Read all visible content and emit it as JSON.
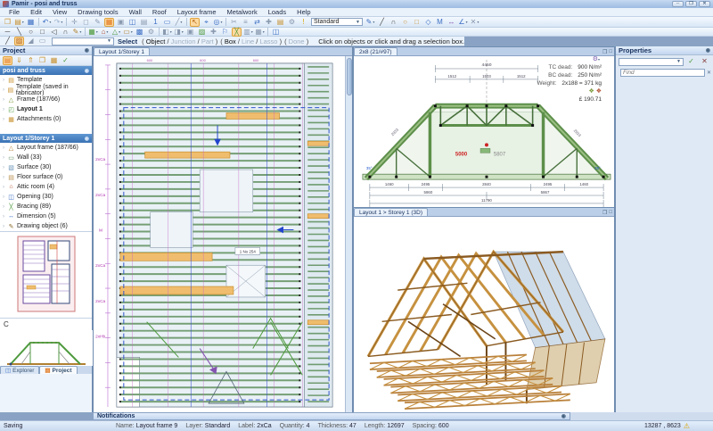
{
  "window": {
    "title": "Pamir - posi and truss",
    "buttons": [
      "─",
      "❐",
      "✕"
    ]
  },
  "menu": {
    "items": [
      "File",
      "Edit",
      "View",
      "Drawing tools",
      "Wall",
      "Roof",
      "Layout frame",
      "Metalwork",
      "Loads",
      "Help"
    ]
  },
  "toolbar1": {
    "standard_combo": "Standard",
    "icons": [
      {
        "name": "new-document-icon",
        "glyph": "❒",
        "color": "#c8922f"
      },
      {
        "name": "open-project-icon",
        "glyph": "▤",
        "color": "#c8922f",
        "dd": true
      },
      {
        "name": "save-icon",
        "glyph": "▦",
        "color": "#3c6fc4"
      },
      {
        "sep": true
      },
      {
        "name": "undo-icon",
        "glyph": "↶",
        "color": "#3c6fc4",
        "dd": true
      },
      {
        "name": "redo-icon",
        "glyph": "↷",
        "color": "#9db4d0",
        "dd": true
      },
      {
        "sep": true
      },
      {
        "name": "pan-icon",
        "glyph": "✛",
        "color": "#8a9ab0"
      },
      {
        "name": "zoom-extents-icon",
        "glyph": "◻",
        "color": "#8a9ab0"
      },
      {
        "name": "edit-icon",
        "glyph": "✎",
        "color": "#8a9ab0"
      },
      {
        "name": "layout-view-icon",
        "glyph": "▦",
        "color": "#e07820",
        "hl": true
      },
      {
        "name": "frame-view-icon",
        "glyph": "▣",
        "color": "#8a9ab0"
      },
      {
        "name": "picture-icon",
        "glyph": "◫",
        "color": "#3c6fc4"
      },
      {
        "name": "sheet-icon",
        "glyph": "▤",
        "color": "#8a9ab0"
      },
      {
        "name": "page-number-icon",
        "glyph": "1",
        "color": "#3c6fc4"
      },
      {
        "name": "monitor-icon",
        "glyph": "▭",
        "color": "#3c6fc4"
      },
      {
        "name": "slash-tool-icon",
        "glyph": "╱",
        "color": "#8a9ab0",
        "dd": true
      },
      {
        "sep": true
      },
      {
        "name": "select-pointer-icon",
        "glyph": "↖",
        "color": "#b06010",
        "hl": true
      },
      {
        "name": "snap-icon",
        "glyph": "⌖",
        "color": "#3c6fc4"
      },
      {
        "name": "zoom-icon",
        "glyph": "◎",
        "color": "#3c6fc4",
        "dd": true
      },
      {
        "sep": true
      },
      {
        "name": "cut-icon",
        "glyph": "✂",
        "color": "#8a9ab0"
      },
      {
        "name": "measure-icon",
        "glyph": "≡",
        "color": "#8a9ab0"
      },
      {
        "name": "move-icon",
        "glyph": "⇄",
        "color": "#3c6fc4"
      },
      {
        "name": "fit-icon",
        "glyph": "✚",
        "color": "#8a9ab0"
      },
      {
        "name": "folder-icon",
        "glyph": "▤",
        "color": "#c8922f"
      },
      {
        "name": "tools-icon",
        "glyph": "⚙",
        "color": "#8a9ab0"
      },
      {
        "name": "lamp-icon",
        "glyph": "!",
        "color": "#d9a400"
      }
    ],
    "icons_after": [
      {
        "name": "pen-style-icon",
        "glyph": "✎",
        "color": "#3c6fc4",
        "dd": true
      },
      {
        "name": "line-tool-icon",
        "glyph": "╱",
        "color": "#444"
      },
      {
        "name": "arc-tool-icon",
        "glyph": "∩",
        "color": "#444"
      },
      {
        "name": "circle-tool-icon",
        "glyph": "○",
        "color": "#c8922f"
      },
      {
        "name": "rect-tool-icon",
        "glyph": "□",
        "color": "#c8922f"
      },
      {
        "name": "polygon-tool-icon",
        "glyph": "◇",
        "color": "#3c6fc4"
      },
      {
        "name": "text-tool-icon",
        "glyph": "M",
        "color": "#3c6fc4"
      },
      {
        "name": "dimension-tool-icon",
        "glyph": "↔",
        "color": "#8455b0"
      },
      {
        "name": "angle-tool-icon",
        "glyph": "∠",
        "color": "#3c6fc4",
        "dd": true
      },
      {
        "name": "eraser-tool-icon",
        "glyph": "✕",
        "color": "#8a9ab0",
        "dd": true
      }
    ]
  },
  "toolbar2": {
    "icons": [
      {
        "name": "draw-line-icon",
        "glyph": "─",
        "color": "#444"
      },
      {
        "name": "draw-diagonal-icon",
        "glyph": "╲",
        "color": "#444"
      },
      {
        "name": "draw-circle-icon",
        "glyph": "○",
        "color": "#444"
      },
      {
        "name": "draw-rect-icon",
        "glyph": "□",
        "color": "#444"
      },
      {
        "name": "draw-triangle-icon",
        "glyph": "◁",
        "color": "#444"
      },
      {
        "name": "draw-arc-icon",
        "glyph": "∩",
        "color": "#444"
      },
      {
        "name": "draw-pen-icon",
        "glyph": "✎",
        "color": "#b08030",
        "dd": true
      },
      {
        "sep": true
      },
      {
        "name": "wall-tool-icon",
        "glyph": "▦",
        "color": "#4e9a3e",
        "dd": true
      },
      {
        "name": "roof-tool-icon",
        "glyph": "⌂",
        "color": "#b05030",
        "dd": true
      },
      {
        "name": "truss-tool-icon",
        "glyph": "△",
        "color": "#4e9a3e",
        "dd": true
      },
      {
        "name": "beam-tool-icon",
        "glyph": "▭",
        "color": "#b08030",
        "dd": true
      },
      {
        "name": "panel-tool-icon",
        "glyph": "▩",
        "color": "#3c6fc4"
      },
      {
        "name": "settings-icon",
        "glyph": "⚙",
        "color": "#8a9ab0"
      },
      {
        "sep": true
      },
      {
        "name": "lock-left-icon",
        "glyph": "◧",
        "color": "#8a9ab0",
        "dd": true
      },
      {
        "name": "lock-right-icon",
        "glyph": "◨",
        "color": "#8a9ab0",
        "dd": true
      },
      {
        "name": "stamp-icon",
        "glyph": "▣",
        "color": "#8a9ab0"
      },
      {
        "name": "fill-icon",
        "glyph": "▨",
        "color": "#4e9a3e"
      },
      {
        "name": "cross-icon",
        "glyph": "✚",
        "color": "#8a9ab0"
      },
      {
        "name": "flag-icon",
        "glyph": "⚐",
        "color": "#3c6fc4"
      },
      {
        "name": "bracing-tool-icon",
        "glyph": "╳",
        "color": "#4e9a3e",
        "hl": true
      },
      {
        "name": "metalwork-icon",
        "glyph": "▥",
        "color": "#8a9ab0",
        "dd": true
      },
      {
        "name": "grid-icon",
        "glyph": "▦",
        "color": "#8a9ab0",
        "dd": true
      },
      {
        "sep": true
      },
      {
        "name": "image-icon",
        "glyph": "◫",
        "color": "#3c6fc4"
      }
    ]
  },
  "toolbar3": {
    "icons": [
      {
        "name": "quick-line-icon",
        "glyph": "╱",
        "color": "#444"
      },
      {
        "name": "highlight-icon",
        "glyph": "▨",
        "color": "#b06010",
        "hl": true
      },
      {
        "name": "corner-icon",
        "glyph": "◢",
        "color": "#8a9ab0"
      },
      {
        "name": "bar-icon",
        "glyph": "▭",
        "color": "#8a9ab0"
      }
    ]
  },
  "prompt": {
    "select": "Select",
    "groups": [
      {
        "items": [
          {
            "t": "Object",
            "en": true
          },
          {
            "t": "Junction",
            "en": false
          },
          {
            "t": "Part",
            "en": false
          }
        ]
      },
      {
        "items": [
          {
            "t": "Box",
            "en": true
          },
          {
            "t": "Line",
            "en": false
          },
          {
            "t": "Lasso",
            "en": false
          }
        ]
      },
      {
        "items": [
          {
            "t": "Done",
            "en": false
          }
        ]
      }
    ],
    "hint": "Click on objects or click and drag a selection box."
  },
  "project_panel": {
    "title": "Project",
    "tools": [
      {
        "name": "new-template-icon",
        "glyph": "▤",
        "color": "#e07820",
        "hl": true
      },
      {
        "name": "import-icon",
        "glyph": "⇓",
        "color": "#c8922f"
      },
      {
        "name": "export-icon",
        "glyph": "⇑",
        "color": "#c8922f"
      },
      {
        "name": "copy-icon",
        "glyph": "❐",
        "color": "#c8922f"
      },
      {
        "name": "list-icon",
        "glyph": "▦",
        "color": "#c8922f"
      },
      {
        "name": "check-icon",
        "glyph": "✓",
        "color": "#4e9a3e"
      }
    ],
    "sections": [
      {
        "title": "posi and truss",
        "items": [
          {
            "label": "Template",
            "icon": "template-icon",
            "glyph": "▤",
            "color": "#c8922f"
          },
          {
            "label": "Template (saved in fabricator)",
            "icon": "template-fabricator-icon",
            "glyph": "▤",
            "color": "#c8922f"
          },
          {
            "label": "Frame (187/66)",
            "icon": "frame-icon",
            "glyph": "△",
            "color": "#7a9a3a"
          },
          {
            "label": "Layout 1",
            "icon": "layout-icon",
            "glyph": "◰",
            "color": "#4e9a3e",
            "bold": true
          },
          {
            "label": "Attachments (0)",
            "icon": "attachments-icon",
            "glyph": "▦",
            "color": "#c8922f"
          }
        ]
      },
      {
        "title": "Layout 1/Storey 1",
        "items": [
          {
            "label": "Layout frame (187/66)",
            "icon": "layout-frame-icon",
            "glyph": "△",
            "color": "#b08030"
          },
          {
            "label": "Wall (33)",
            "icon": "wall-icon",
            "glyph": "▭",
            "color": "#5a8a5a"
          },
          {
            "label": "Surface (30)",
            "icon": "surface-icon",
            "glyph": "▧",
            "color": "#6a94b8"
          },
          {
            "label": "Floor surface (0)",
            "icon": "floor-surface-icon",
            "glyph": "▤",
            "color": "#b89050"
          },
          {
            "label": "Attic room (4)",
            "icon": "attic-room-icon",
            "glyph": "⌂",
            "color": "#b05030"
          },
          {
            "label": "Opening (30)",
            "icon": "opening-icon",
            "glyph": "◫",
            "color": "#3c6fc4"
          },
          {
            "label": "Bracing (89)",
            "icon": "bracing-icon",
            "glyph": "╳",
            "color": "#4e9a3e"
          },
          {
            "label": "Dimension (5)",
            "icon": "dimension-icon",
            "glyph": "↔",
            "color": "#3c6fc4"
          },
          {
            "label": "Drawing object (6)",
            "icon": "drawing-object-icon",
            "glyph": "✎",
            "color": "#8a6a2a"
          }
        ]
      }
    ],
    "thumb_label": "C"
  },
  "side_tabs": {
    "explorer": "Explorer",
    "project": "Project"
  },
  "main_view": {
    "tab": "Layout 1/Storey 1",
    "left_labels": [
      "2xCa",
      "2xCa",
      "M",
      "2xCa",
      "2xCa",
      "2xHb"
    ],
    "spacing_labels": [
      "600",
      "600",
      "600"
    ],
    "tag_label": "1 No 254"
  },
  "truss_view": {
    "tab": "2x8 (21/#97)",
    "tc_dead_label": "TC dead:",
    "tc_dead": "900 N/m²",
    "bc_dead_label": "BC dead:",
    "bc_dead": "250 N/m²",
    "weight_label": "Weight:",
    "weight": "2x188 = 371 kg",
    "price": "£ 190.71",
    "dim_top_total": "4450",
    "dims_top": [
      "1512",
      "1503",
      "1512"
    ],
    "slope_dim_left": "2933",
    "slope_dim_right": "2933",
    "dim_red": "5000",
    "dim_gray": "5807",
    "dims_bottom": [
      "1460",
      "2495",
      "2840",
      "2495",
      "1460"
    ],
    "dims_half": [
      "5860",
      "5867"
    ],
    "dim_total": "11790",
    "pitch_left": "35°",
    "pitch_right": "35°"
  },
  "view3d": {
    "tab": "Layout 1 > Storey 1 (3D)"
  },
  "properties": {
    "title": "Properties",
    "find_placeholder": "Find"
  },
  "notifications": {
    "title": "Notifications"
  },
  "status": {
    "left": "Saving",
    "fields": [
      {
        "label": "Name:",
        "value": "Layout frame 9"
      },
      {
        "label": "Layer:",
        "value": "Standard"
      },
      {
        "label": "Label:",
        "value": "2xCa"
      },
      {
        "label": "Quantity:",
        "value": "4"
      },
      {
        "label": "Thickness:",
        "value": "47"
      },
      {
        "label": "Length:",
        "value": "12697"
      },
      {
        "label": "Spacing:",
        "value": "600"
      }
    ],
    "coords": "13287 , 8623"
  }
}
